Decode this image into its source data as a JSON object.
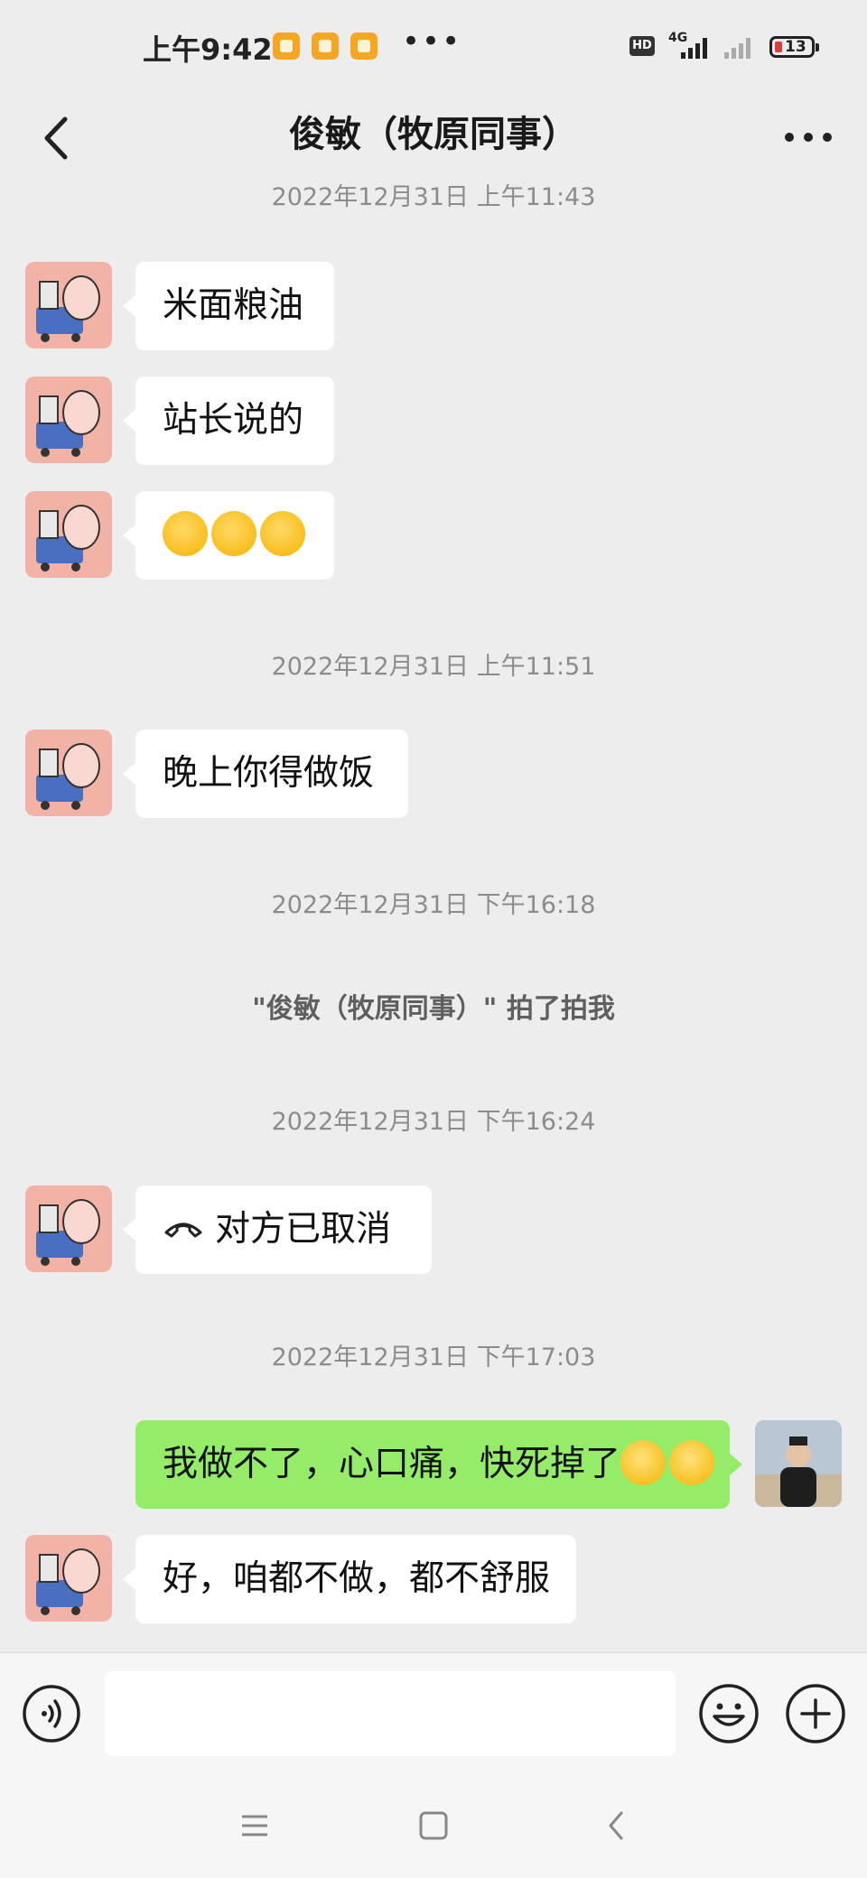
{
  "status_bar": {
    "time": "上午9:42",
    "hd": "HD",
    "network": "4G",
    "battery": "13"
  },
  "header": {
    "title": "俊敏（牧原同事）"
  },
  "timestamps": [
    "2022年12月31日 上午11:43",
    "2022年12月31日 上午11:51",
    "2022年12月31日 下午16:18",
    "2022年12月31日 下午16:24",
    "2022年12月31日 下午17:03"
  ],
  "system_message": "\"俊敏（牧原同事）\" 拍了拍我",
  "messages": [
    {
      "side": "left",
      "text": "米面粮油"
    },
    {
      "side": "left",
      "text": "站长说的"
    },
    {
      "side": "left",
      "text": "",
      "emojis": [
        "sad-sigh-emoji",
        "sad-sigh-emoji",
        "sad-sigh-emoji"
      ]
    },
    {
      "side": "left",
      "text": "晚上你得做饭"
    },
    {
      "side": "left",
      "text": "对方已取消",
      "icon": "hang-up-phone-icon"
    },
    {
      "side": "right",
      "text": "我做不了，心口痛，快死掉了",
      "emojis": [
        "eye-roll-emoji",
        "eye-roll-emoji"
      ]
    },
    {
      "side": "left",
      "text": "好，咱都不做，都不舒服"
    }
  ],
  "colors": {
    "background": "#ededed",
    "bubble_incoming": "#ffffff",
    "bubble_outgoing": "#95ec69"
  }
}
